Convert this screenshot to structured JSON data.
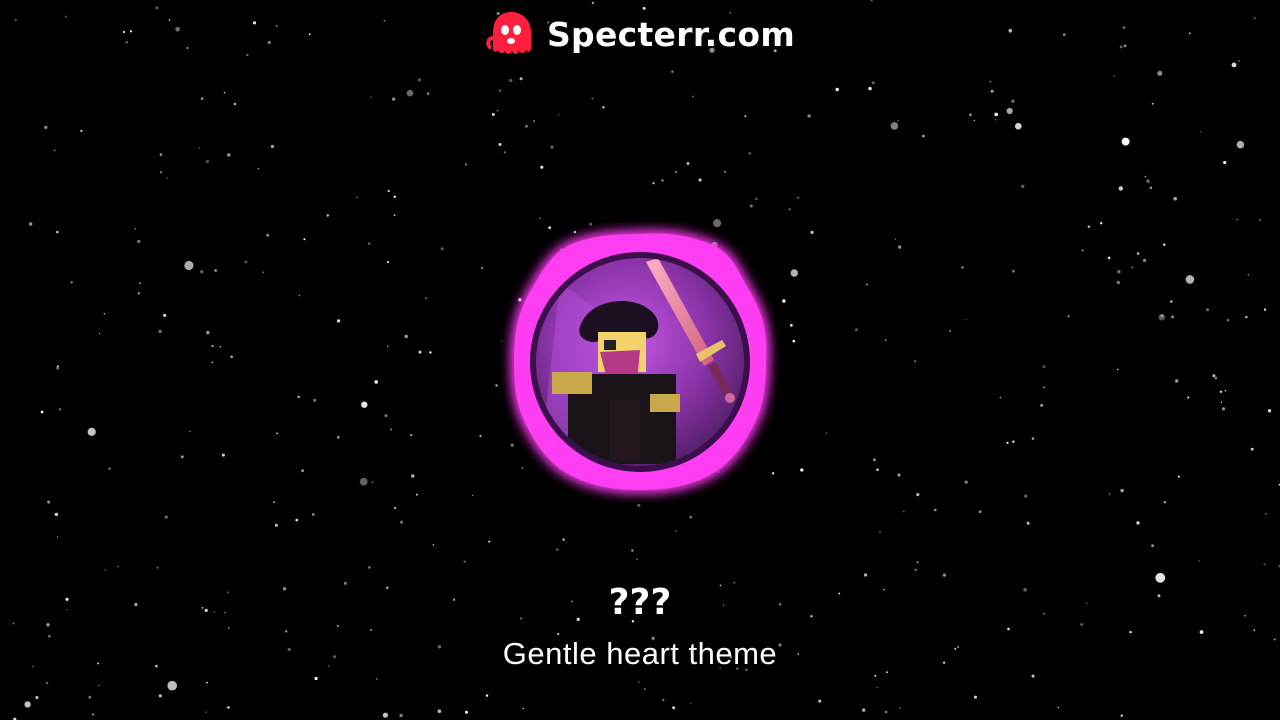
{
  "watermark": {
    "text": "Specterr.com",
    "icon": "ghost-icon",
    "icon_color": "#ff1e3c"
  },
  "visualizer": {
    "ring_color": "#ff3df2",
    "glow_color": "#d400ff",
    "artwork": "roblox-character-with-sword"
  },
  "track": {
    "title": "???",
    "subtitle": "Gentle heart theme"
  },
  "colors": {
    "background": "#000000",
    "text": "#ffffff"
  }
}
